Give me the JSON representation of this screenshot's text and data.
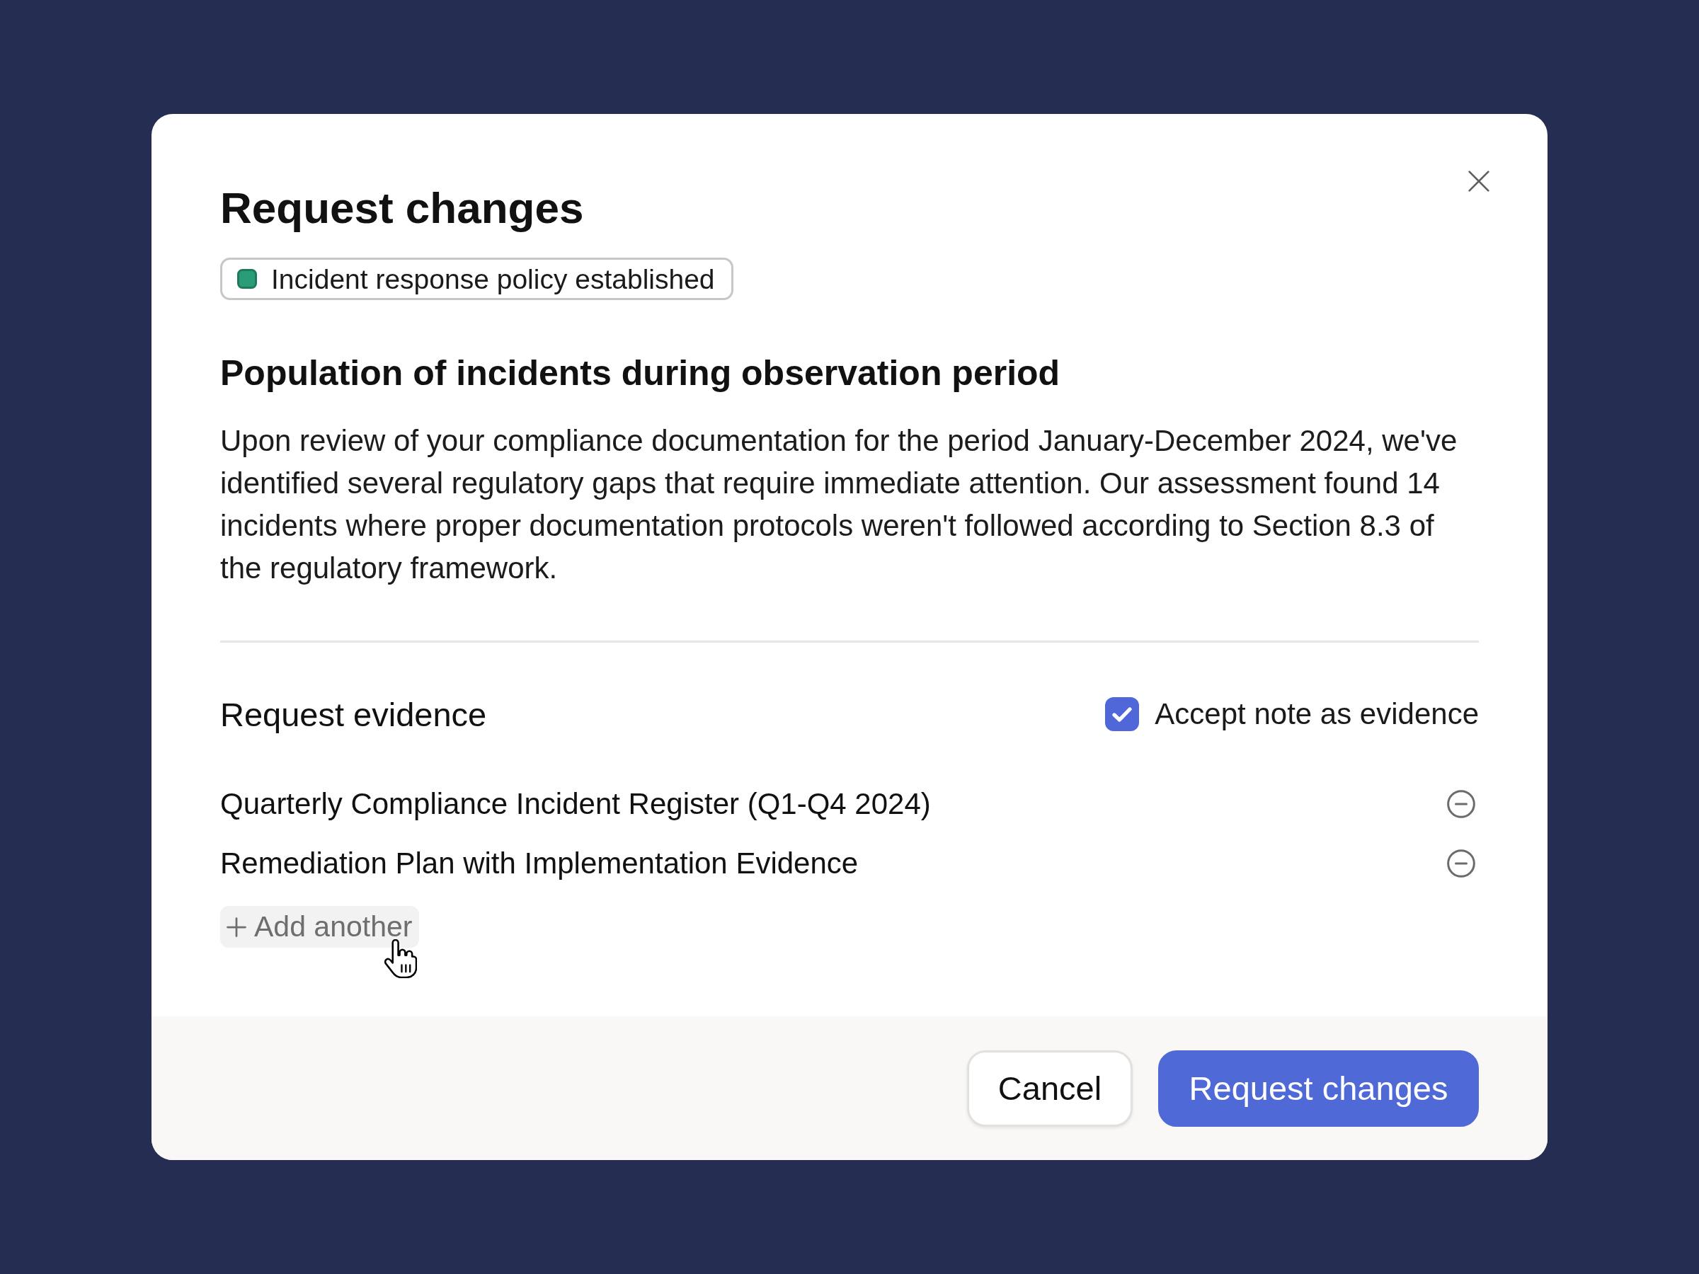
{
  "dialog": {
    "title": "Request changes",
    "tag": {
      "label": "Incident response policy established"
    }
  },
  "section": {
    "heading": "Population of incidents during observation period",
    "body": "Upon review of your compliance documentation for the period January-December 2024, we've identified several regulatory gaps that require immediate attention. Our assessment found 14 incidents where proper documentation protocols weren't followed according to Section 8.3 of the regulatory framework."
  },
  "evidence": {
    "heading": "Request evidence",
    "accept_note": {
      "label": "Accept note as evidence",
      "checked": true
    },
    "items": [
      {
        "label": "Quarterly Compliance Incident Register (Q1-Q4 2024)"
      },
      {
        "label": "Remediation Plan with Implementation Evidence"
      }
    ],
    "add_label": "Add another"
  },
  "footer": {
    "buttons": [
      {
        "label": "Cancel",
        "kind": "secondary"
      },
      {
        "label": "Request changes",
        "kind": "primary"
      }
    ]
  }
}
